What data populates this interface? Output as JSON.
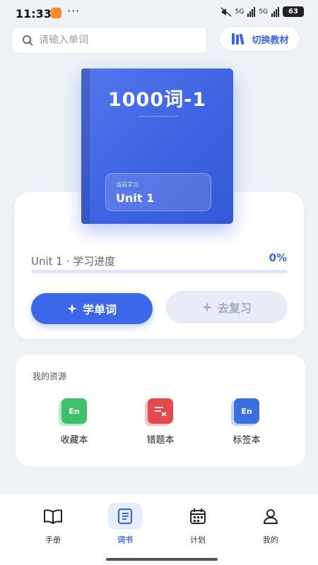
{
  "status_bar": {
    "time": "11:33",
    "signal1": "5G",
    "signal2": "5G",
    "battery": "63"
  },
  "search": {
    "placeholder": "请输入单词"
  },
  "switch_button": {
    "label": "切换教材"
  },
  "book": {
    "title": "1000词-1",
    "current_caption": "当前学习",
    "current_unit": "Unit 1"
  },
  "progress": {
    "label": "Unit 1 · 学习进度",
    "percent_text": "0%",
    "percent_value": 0
  },
  "actions": {
    "learn_label": "学单词",
    "review_label": "去复习"
  },
  "resources": {
    "title": "我的资源",
    "items": [
      {
        "label": "收藏本",
        "icon": "en-book-green-icon",
        "icon_text": "En"
      },
      {
        "label": "错题本",
        "icon": "mistake-book-red-icon",
        "icon_text": ""
      },
      {
        "label": "标签本",
        "icon": "en-book-blue-icon",
        "icon_text": "En"
      }
    ]
  },
  "nav": {
    "items": [
      {
        "label": "手册",
        "icon": "open-book-icon",
        "active": false
      },
      {
        "label": "词书",
        "icon": "word-book-icon",
        "active": true
      },
      {
        "label": "计划",
        "icon": "calendar-icon",
        "active": false
      },
      {
        "label": "我的",
        "icon": "user-icon",
        "active": false
      }
    ]
  },
  "colors": {
    "accent": "#3a66e8",
    "book": "#4a6ee8",
    "green": "#3fbf6b",
    "red": "#e5484d",
    "blue": "#3b6fe0"
  }
}
